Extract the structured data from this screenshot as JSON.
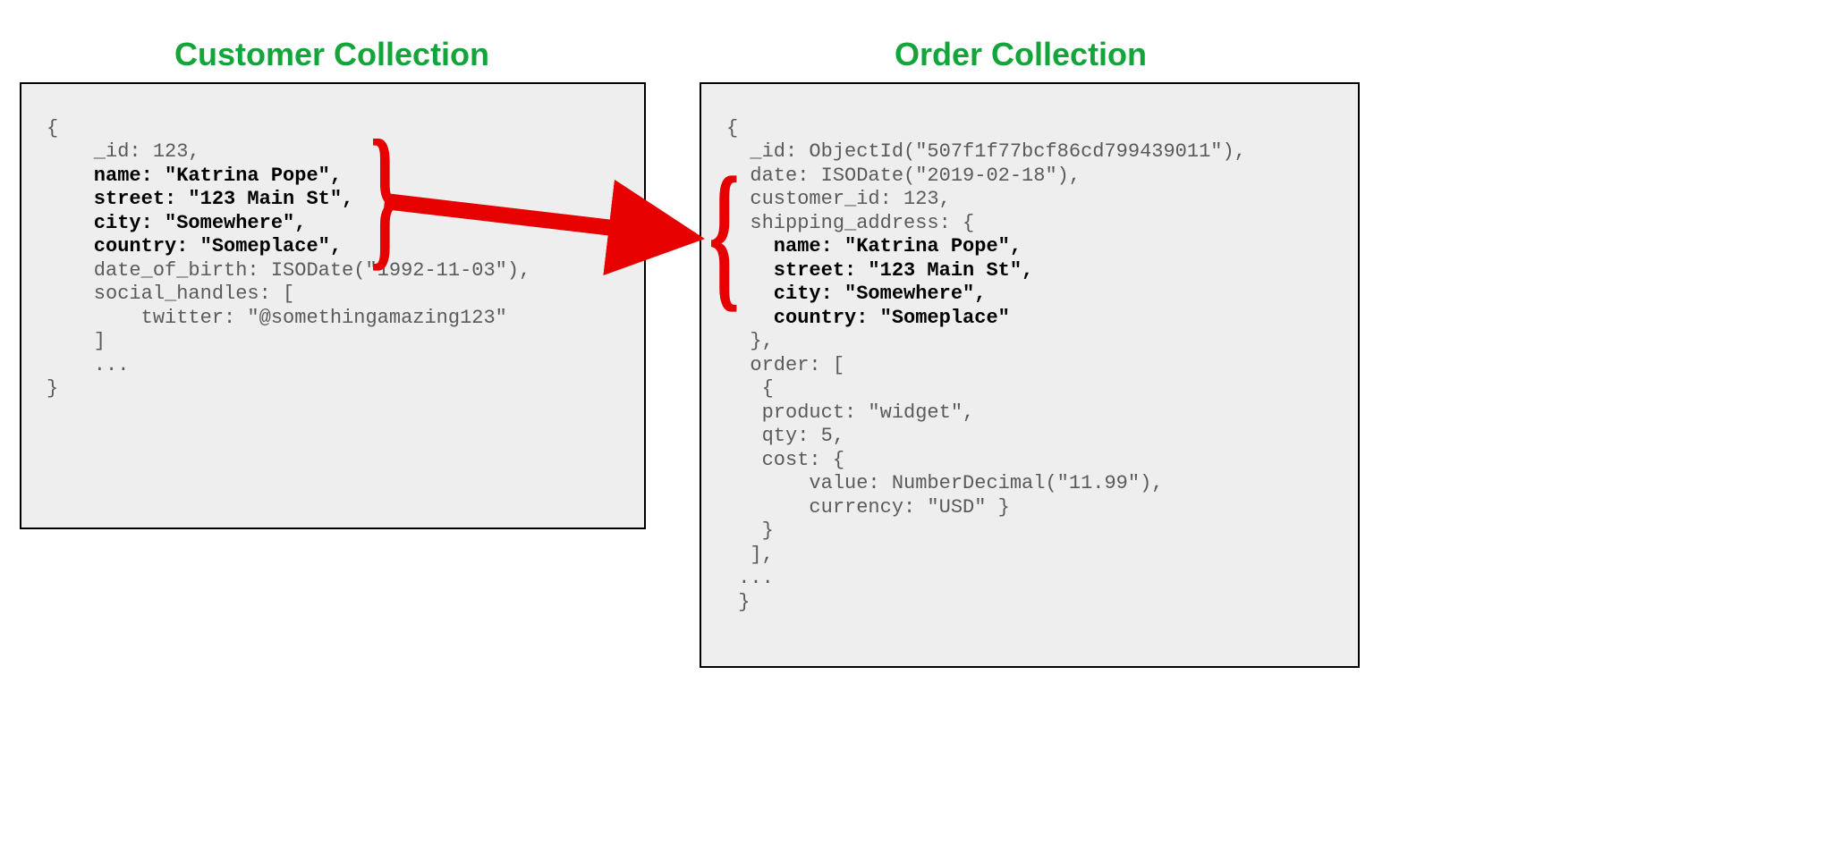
{
  "customer": {
    "title": "Customer Collection",
    "code_pre": "{\n    _id: 123,",
    "code_bold1": "    name: \"Katrina Pope\",",
    "code_bold2": "    street: \"123 Main St\",",
    "code_bold3": "    city: \"Somewhere\",",
    "code_bold4": "    country: \"Someplace\",",
    "code_post": "    date_of_birth: ISODate(\"1992-11-03\"),\n    social_handles: [\n        twitter: \"@somethingamazing123\"\n    ]\n    ...\n}"
  },
  "order": {
    "title": "Order Collection",
    "code_pre": "{\n  _id: ObjectId(\"507f1f77bcf86cd799439011\"),\n  date: ISODate(\"2019-02-18\"),\n  customer_id: 123,\n  shipping_address: {",
    "code_bold1": "    name: \"Katrina Pope\",",
    "code_bold2": "    street: \"123 Main St\",",
    "code_bold3": "    city: \"Somewhere\",",
    "code_bold4": "    country: \"Someplace\"",
    "code_post": "  },\n  order: [\n   {\n   product: \"widget\",\n   qty: 5,\n   cost: {\n       value: NumberDecimal(\"11.99\"),\n       currency: \"USD\" }\n   }\n  ],\n ...\n }"
  },
  "braces": {
    "right": "}",
    "left": "{"
  }
}
